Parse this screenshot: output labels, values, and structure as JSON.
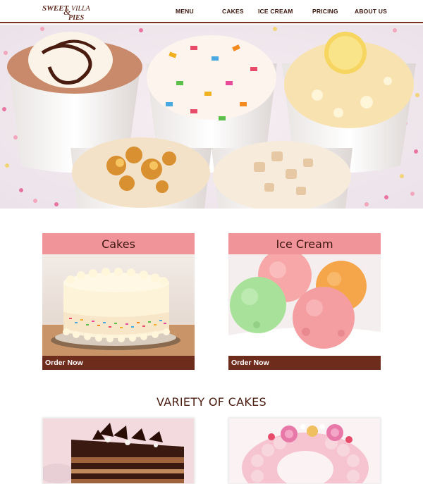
{
  "brand": {
    "logo_lines": [
      "SWEET",
      "&",
      "VILLA",
      "PIES"
    ],
    "name": "Sweet Villa Pies"
  },
  "nav": {
    "items": [
      "MENU",
      "CAKES",
      "ICE CREAM",
      "PRICING",
      "ABOUT US"
    ]
  },
  "cards": [
    {
      "title": "Cakes",
      "action": "Order Now"
    },
    {
      "title": "Ice Cream",
      "action": "Order Now"
    }
  ],
  "section": {
    "title": "VARIETY OF CAKES"
  },
  "colors": {
    "brand_brown": "#6e2c1c",
    "card_header_pink": "#f0949a",
    "nav_text": "#3b160d"
  }
}
